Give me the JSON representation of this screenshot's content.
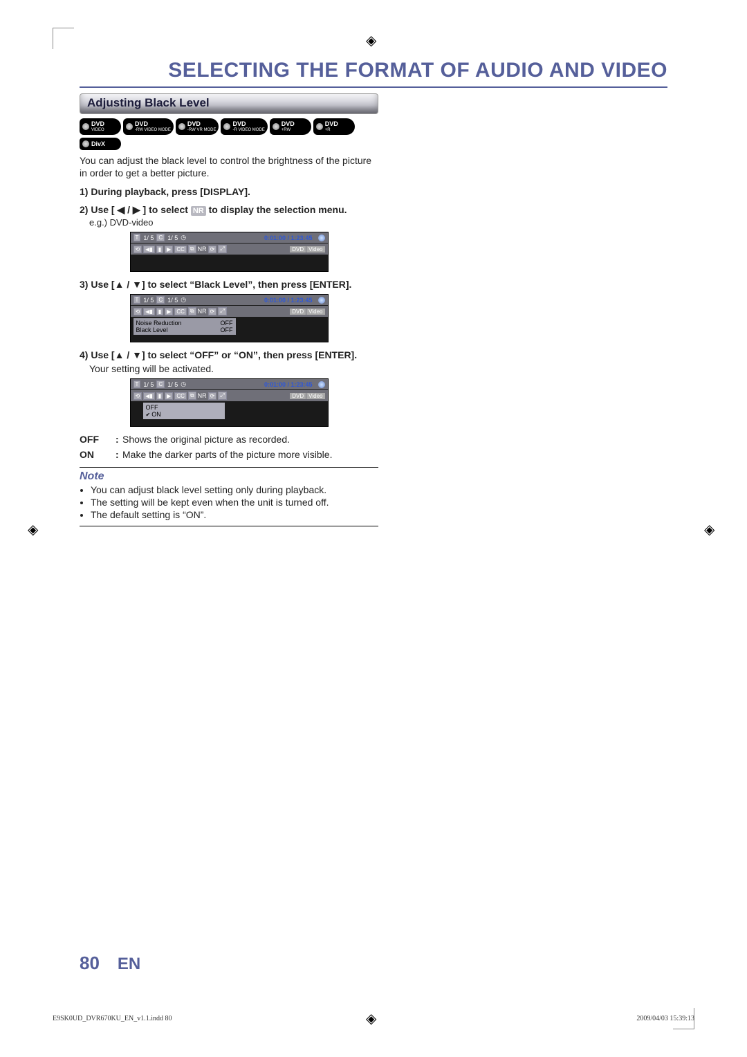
{
  "title": "SELECTING THE FORMAT OF AUDIO AND VIDEO",
  "section_heading": "Adjusting Black Level",
  "badges": [
    {
      "main": "DVD",
      "sub": "VIDEO"
    },
    {
      "main": "DVD",
      "sub": "-RW VIDEO MODE"
    },
    {
      "main": "DVD",
      "sub": "-RW VR MODE"
    },
    {
      "main": "DVD",
      "sub": "-R VIDEO MODE"
    },
    {
      "main": "DVD",
      "sub": "+RW"
    },
    {
      "main": "DVD",
      "sub": "+R"
    }
  ],
  "badge_extra": "DivX",
  "intro": "You can adjust the black level to control the brightness of the picture in order to get a better picture.",
  "step1": "1) During playback, press [DISPLAY].",
  "step2_pre": "2) Use [ ",
  "step2_arrows": "◀ / ▶",
  "step2_mid": " ] to select ",
  "step2_nr": "NR",
  "step2_post": " to display the selection menu.",
  "step2_eg": "e.g.) DVD-video",
  "step3_pre": "3) Use [",
  "step3_arrows": "▲ / ▼",
  "step3_post": "] to select “Black Level”, then press [ENTER].",
  "step4_pre": "4) Use [",
  "step4_arrows": "▲ / ▼",
  "step4_post": "] to select “OFF” or “ON”, then press [ENTER].",
  "step4_line2": "Your setting will be activated.",
  "osd": {
    "title_t": "T",
    "title_c": "C",
    "tc1": "1/  5",
    "tc2": "1/  5",
    "clock_icon": "◷",
    "time": "0:01:00 / 1:23:45",
    "dvd": "DVD",
    "video": "Video",
    "icons": [
      "⟲",
      "◀▮",
      "▮",
      "▶",
      "CC",
      "⧉",
      "NR",
      "⟳",
      "⤢"
    ],
    "nr_label": "Noise Reduction",
    "nr_val": "OFF",
    "bl_label": "Black Level",
    "bl_val": "OFF",
    "opt_off": "OFF",
    "opt_on": "ON"
  },
  "defs": {
    "off_k": "OFF",
    "off_v": "Shows the original picture as recorded.",
    "on_k": "ON",
    "on_v": "Make the darker parts of the picture more visible."
  },
  "note_title": "Note",
  "notes": [
    "You can adjust black level setting only during playback.",
    "The setting will be kept even when the unit is turned off.",
    "The default setting is “ON”."
  ],
  "page_number": "80",
  "lang": "EN",
  "imprint_left": "E9SK0UD_DVR670KU_EN_v1.1.indd   80",
  "imprint_right": "2009/04/03   15:39:13"
}
